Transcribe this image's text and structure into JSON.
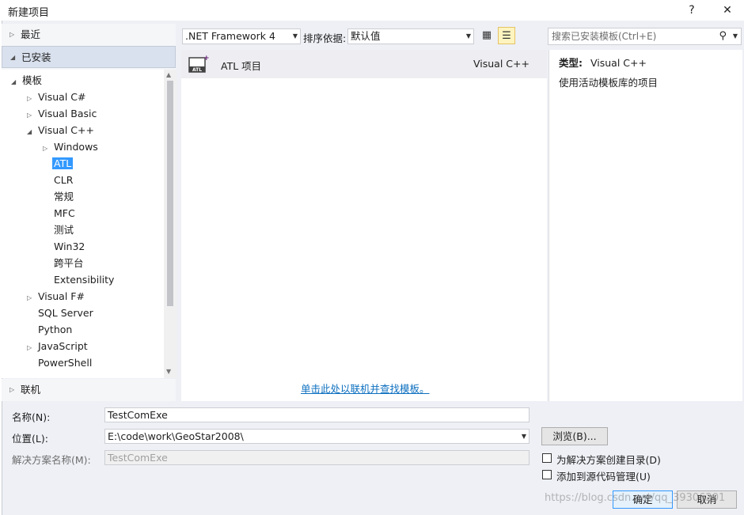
{
  "window": {
    "title": "新建项目",
    "help_label": "?",
    "close_label": "✕"
  },
  "nav": {
    "recent": "最近",
    "installed": "已安装",
    "online": "联机",
    "tree": [
      {
        "label": "模板",
        "level": 0,
        "expander": "expanded"
      },
      {
        "label": "Visual C#",
        "level": 1,
        "expander": "collapsed"
      },
      {
        "label": "Visual Basic",
        "level": 1,
        "expander": "collapsed"
      },
      {
        "label": "Visual C++",
        "level": 1,
        "expander": "expanded"
      },
      {
        "label": "Windows",
        "level": 2,
        "expander": "collapsed"
      },
      {
        "label": "ATL",
        "level": 2,
        "expander": "none",
        "selected": true
      },
      {
        "label": "CLR",
        "level": 2,
        "expander": "none"
      },
      {
        "label": "常规",
        "level": 2,
        "expander": "none"
      },
      {
        "label": "MFC",
        "level": 2,
        "expander": "none"
      },
      {
        "label": "测试",
        "level": 2,
        "expander": "none"
      },
      {
        "label": "Win32",
        "level": 2,
        "expander": "none"
      },
      {
        "label": "跨平台",
        "level": 2,
        "expander": "none"
      },
      {
        "label": "Extensibility",
        "level": 2,
        "expander": "none"
      },
      {
        "label": "Visual F#",
        "level": 1,
        "expander": "collapsed"
      },
      {
        "label": "SQL Server",
        "level": 1,
        "expander": "none"
      },
      {
        "label": "Python",
        "level": 1,
        "expander": "none"
      },
      {
        "label": "JavaScript",
        "level": 1,
        "expander": "collapsed"
      },
      {
        "label": "PowerShell",
        "level": 1,
        "expander": "none"
      }
    ]
  },
  "toolbar": {
    "framework": ".NET Framework 4",
    "sort_label": "排序依据:",
    "sort_value": "默认值",
    "search_placeholder": "搜索已安装模板(Ctrl+E)"
  },
  "templates": [
    {
      "name": "ATL 项目",
      "language": "Visual C++",
      "icon": "atl-project-icon"
    }
  ],
  "online_link": "单击此处以联机并查找模板。",
  "description": {
    "type_label": "类型:",
    "type_value": "Visual C++",
    "text": "使用活动模板库的项目"
  },
  "form": {
    "name_label": "名称(N):",
    "name_value": "TestComExe",
    "location_label": "位置(L):",
    "location_value": "E:\\code\\work\\GeoStar2008\\",
    "solution_label": "解决方案名称(M):",
    "solution_value": "TestComExe",
    "browse_label": "浏览(B)...",
    "create_dir_label": "为解决方案创建目录(D)",
    "source_control_label": "添加到源代码管理(U)",
    "ok_label": "确定",
    "cancel_label": "取消"
  },
  "watermark": "https://blog.csdn.net/qq_39306201"
}
